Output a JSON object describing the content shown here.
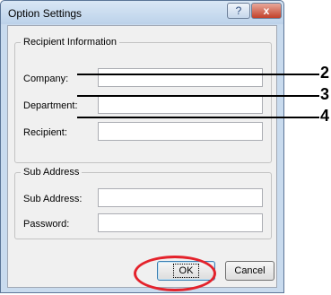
{
  "dialog": {
    "title": "Option Settings",
    "help_symbol": "?",
    "close_symbol": "x"
  },
  "recipient_group": {
    "title": "Recipient Information",
    "company_label": "Company:",
    "department_label": "Department:",
    "recipient_label": "Recipient:",
    "company_value": "",
    "department_value": "",
    "recipient_value": ""
  },
  "sub_address_group": {
    "title": "Sub Address",
    "sub_address_label": "Sub Address:",
    "password_label": "Password:",
    "sub_address_value": "",
    "password_value": ""
  },
  "buttons": {
    "ok": "OK",
    "cancel": "Cancel"
  },
  "callouts": [
    "2",
    "3",
    "4"
  ],
  "colors": {
    "highlight_circle": "#e4222b",
    "close_button": "#c2412a"
  }
}
